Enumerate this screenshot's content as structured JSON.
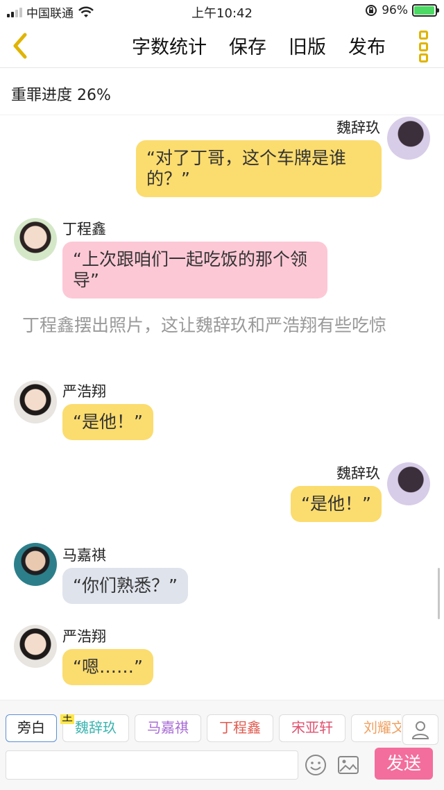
{
  "status_bar": {
    "carrier": "中国联通",
    "time": "上午10:42",
    "battery_percent": "96%",
    "battery_level": 0.96
  },
  "nav": {
    "back_icon": "chevron-left-icon",
    "actions": [
      "字数统计",
      "保存",
      "旧版",
      "发布"
    ],
    "menu_icon": "more-vertical-icon"
  },
  "progress": {
    "text": "重罪进度 26%"
  },
  "chat": {
    "messages": [
      {
        "speaker": "魏辞玖",
        "side": "right",
        "text": "“对了丁哥，这个车牌是谁的？”",
        "color": "#fbdc6e"
      },
      {
        "speaker": "丁程鑫",
        "side": "left",
        "text": "“上次跟咱们一起吃饭的那个领导”",
        "color": "#fdc8d6"
      },
      {
        "narration": "丁程鑫摆出照片，这让魏辞玖和严浩翔有些吃惊"
      },
      {
        "speaker": "严浩翔",
        "side": "left",
        "text": "“是他！”",
        "color": "#fbdc6e"
      },
      {
        "speaker": "魏辞玖",
        "side": "right",
        "text": "“是他！”",
        "color": "#fbdc6e"
      },
      {
        "speaker": "马嘉祺",
        "side": "left",
        "text": "“你们熟悉？”",
        "color": "#dfe3ec"
      },
      {
        "speaker": "严浩翔",
        "side": "left",
        "text": "“嗯……”",
        "color": "#fbdc6e"
      }
    ]
  },
  "bottom": {
    "roles": [
      {
        "label": "旁白",
        "color": "#222222",
        "active": true
      },
      {
        "label": "魏辞玖",
        "color": "#3ab5b0",
        "tag": "主"
      },
      {
        "label": "马嘉祺",
        "color": "#a86bd6"
      },
      {
        "label": "丁程鑫",
        "color": "#e05a4e"
      },
      {
        "label": "宋亚轩",
        "color": "#e0506e"
      },
      {
        "label": "刘耀文",
        "color": "#f0a060"
      }
    ],
    "input_placeholder": "",
    "send_label": "发送"
  }
}
